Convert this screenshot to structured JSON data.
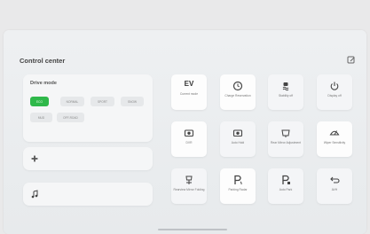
{
  "header": {
    "title": "Control center",
    "edit_icon": "edit-icon"
  },
  "drive_mode": {
    "title": "Drive mode",
    "options": [
      "ECO",
      "NORMAL",
      "SPORT",
      "SNOW",
      "MUD",
      "OFF-ROAD"
    ],
    "selected": "ECO",
    "accent_color": "#2fb84a"
  },
  "cards": {
    "fan_icon": "fan-icon",
    "music_icon": "music-note-icon"
  },
  "tiles": [
    {
      "name": "ev-mode",
      "label": "Current mode",
      "icon_text": "EV",
      "white": true
    },
    {
      "name": "charge-reservation",
      "label": "Charge Reservation",
      "icon": "clock-icon",
      "white": true
    },
    {
      "name": "esc-off",
      "label": "Stability off",
      "icon": "skid-icon",
      "white": false
    },
    {
      "name": "display-off",
      "label": "Display off",
      "icon": "power-icon",
      "white": false
    },
    {
      "name": "dvr",
      "label": "DVR",
      "icon": "camera-icon",
      "white": true
    },
    {
      "name": "auto-hold",
      "label": "Auto Hold",
      "icon": "camera-icon",
      "white": false
    },
    {
      "name": "rear-mirror",
      "label": "Rear Mirror Adjustment",
      "icon": "mirror-icon",
      "white": false
    },
    {
      "name": "wiper",
      "label": "Wiper Sensitivity",
      "icon": "wiper-icon",
      "white": true
    },
    {
      "name": "rear-mirror-folding",
      "label": "Rearview Mirror Folding",
      "icon": "mirror-fold-icon",
      "white": false
    },
    {
      "name": "parking-radar",
      "label": "Parking Radar",
      "icon": "parking-icon",
      "white": true
    },
    {
      "name": "auto-park",
      "label": "Auto Park",
      "icon": "parking-icon",
      "white": false
    },
    {
      "name": "avh",
      "label": "AVH",
      "icon": "hold-icon",
      "white": false
    }
  ]
}
